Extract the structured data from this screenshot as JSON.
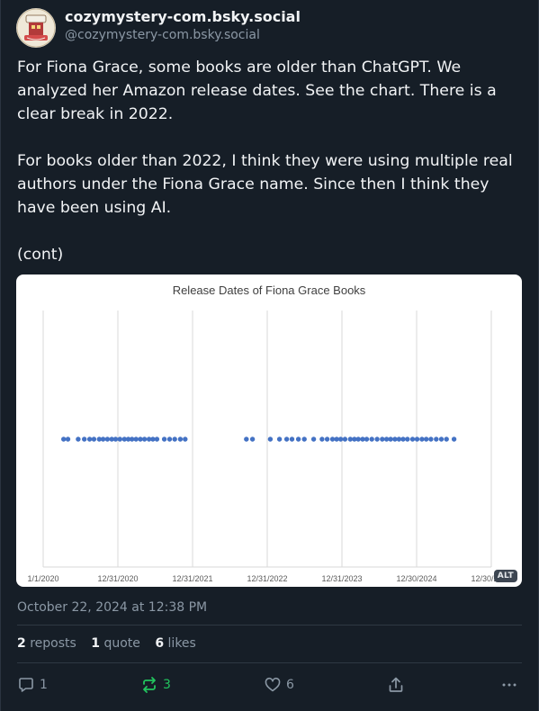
{
  "post": {
    "display_name": "cozymystery-com.bsky.social",
    "handle": "@cozymystery-com.bsky.social",
    "text": "For Fiona Grace, some books are older than ChatGPT. We analyzed her Amazon release dates. See the chart. There is a clear break in 2022.\n\nFor books older than 2022, I think they were using multiple real authors under the Fiona Grace name. Since then I think they have been using AI.\n\n(cont)",
    "timestamp": "October 22, 2024 at 12:38 PM",
    "alt_badge": "ALT"
  },
  "stats": {
    "reposts_count": "2",
    "reposts_label": "reposts",
    "quotes_count": "1",
    "quotes_label": "quote",
    "likes_count": "6",
    "likes_label": "likes"
  },
  "actions": {
    "reply_count": "1",
    "repost_count": "3",
    "like_count": "6"
  },
  "colors": {
    "background": "#161e27",
    "repost_active": "#22c55e",
    "point": "#4472c4"
  },
  "icons": [
    "avatar-logo",
    "reply-icon",
    "repost-icon",
    "like-icon",
    "share-icon",
    "more-icon"
  ],
  "chart_data": {
    "type": "scatter",
    "title": "Release Dates of Fiona Grace Books",
    "xlabel": "",
    "ylabel": "",
    "x_ticks": [
      "1/1/2020",
      "12/31/2020",
      "12/31/2021",
      "12/31/2022",
      "12/31/2023",
      "12/30/2024",
      "12/30/2025"
    ],
    "xlim": [
      "2020-01-01",
      "2025-12-30"
    ],
    "y": 1,
    "grid": "vertical",
    "series": [
      {
        "values": [
          "2020-04-10",
          "2020-05-01",
          "2020-06-20",
          "2020-07-20",
          "2020-08-15",
          "2020-09-05",
          "2020-10-01",
          "2020-10-20",
          "2020-11-10",
          "2020-12-01",
          "2020-12-20",
          "2021-01-10",
          "2021-02-01",
          "2021-02-20",
          "2021-03-10",
          "2021-03-30",
          "2021-04-20",
          "2021-05-10",
          "2021-06-01",
          "2021-06-20",
          "2021-07-10",
          "2021-08-15",
          "2021-09-10",
          "2021-10-05",
          "2021-11-01",
          "2021-11-25",
          "2022-09-20",
          "2022-10-20",
          "2023-01-15",
          "2023-03-01",
          "2023-04-05",
          "2023-05-01",
          "2023-06-01",
          "2023-06-30",
          "2023-08-15",
          "2023-09-25",
          "2023-10-20",
          "2023-11-15",
          "2023-12-05",
          "2023-12-25",
          "2024-01-15",
          "2024-02-10",
          "2024-03-01",
          "2024-03-20",
          "2024-04-10",
          "2024-04-30",
          "2024-05-25",
          "2024-06-20",
          "2024-07-15",
          "2024-08-05",
          "2024-08-25",
          "2024-09-15",
          "2024-10-05",
          "2024-10-25",
          "2024-11-15",
          "2024-12-10",
          "2025-01-01",
          "2025-01-25",
          "2025-02-15",
          "2025-03-10",
          "2025-04-05",
          "2025-04-30",
          "2025-05-25",
          "2025-07-01"
        ]
      }
    ]
  }
}
